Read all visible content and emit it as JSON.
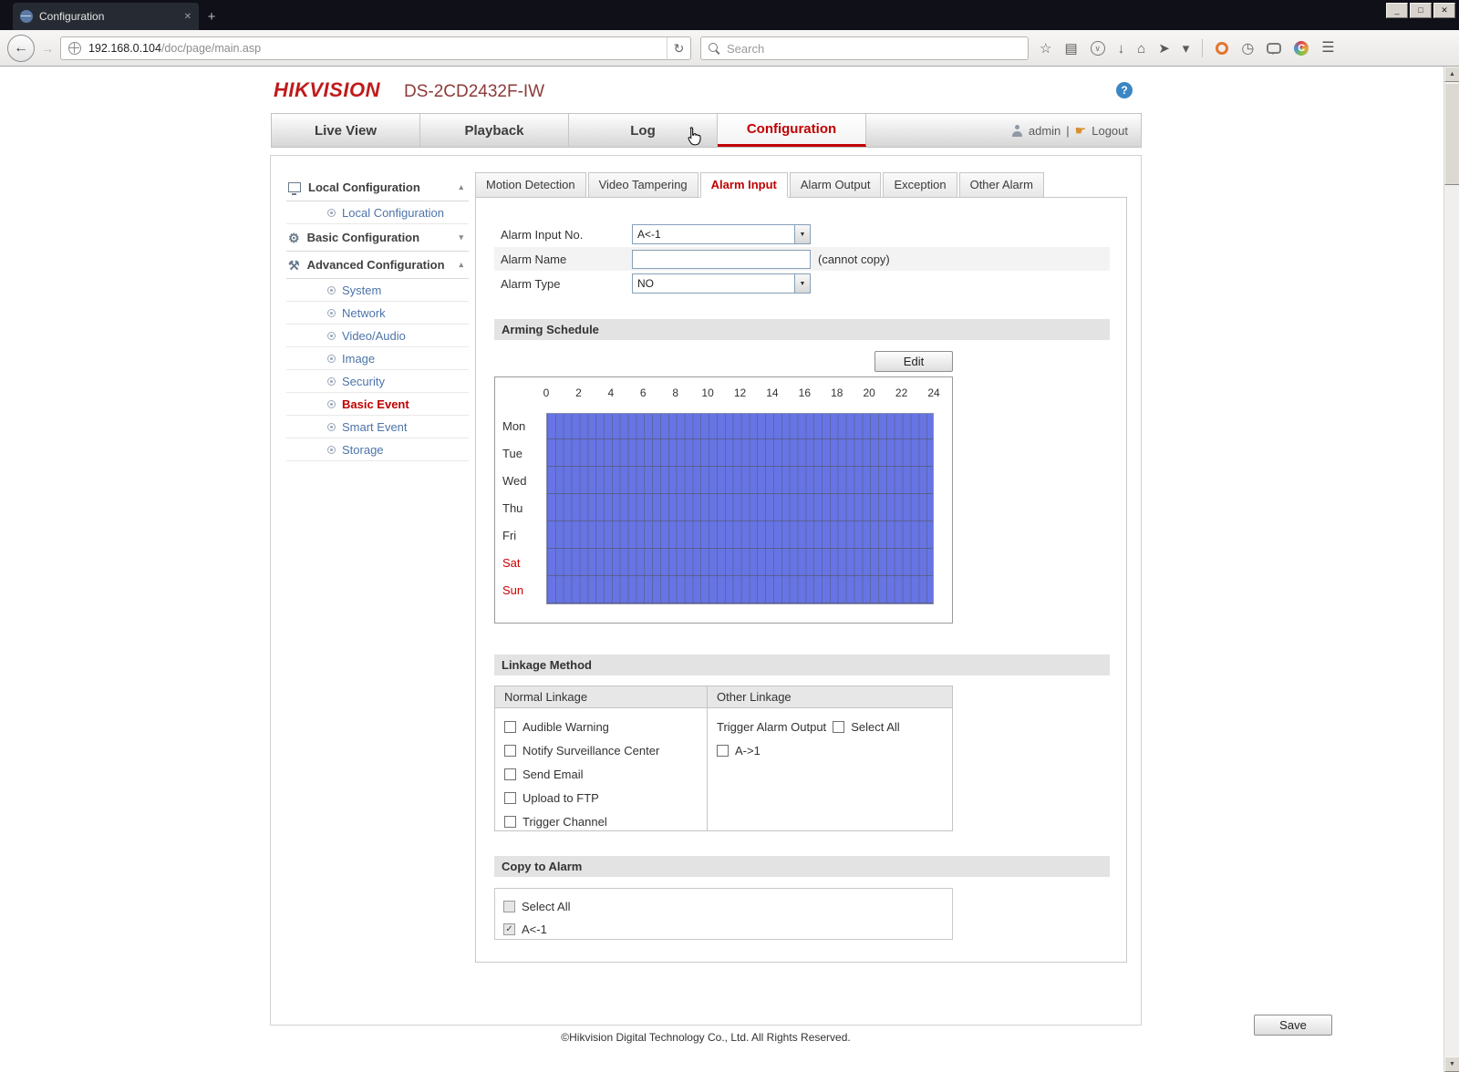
{
  "colors": {
    "accent_red": "#c00000",
    "link_blue": "#4d74a9",
    "schedule_blue": "#6674e4",
    "help_blue": "#3b86c4"
  },
  "icons": {
    "minimize": "_",
    "maximize": "□",
    "close": "✕",
    "tab_close": "✕",
    "new_tab": "+",
    "back": "←",
    "forward": "→",
    "reload": "↻",
    "star": "☆",
    "reading_list": "▤",
    "pocket": "∨",
    "download": "↓",
    "home": "⌂",
    "send": "➤",
    "caret": "▾",
    "menu": "☰",
    "clock": "◷",
    "letter_c": "C",
    "help": "?",
    "chevron_up": "▴",
    "chevron_down": "▾",
    "select_arrow": "▼",
    "check": "✓",
    "scroll_up": "▲",
    "scroll_down": "▼",
    "logout_hand": "☛"
  },
  "browser": {
    "tab_title": "Configuration",
    "url_host": "192.168.0.104",
    "url_path": "/doc/page/main.asp",
    "search_placeholder": "Search"
  },
  "page": {
    "brand": "HIKVISION",
    "model": "DS-2CD2432F-IW",
    "nav_tabs": [
      {
        "label": "Live View"
      },
      {
        "label": "Playback"
      },
      {
        "label": "Log"
      },
      {
        "label": "Configuration"
      }
    ],
    "user": "admin",
    "user_sep": "|",
    "logout_label": "Logout",
    "footer": "©Hikvision Digital Technology Co., Ltd. All Rights Reserved."
  },
  "sidebar": {
    "groups": [
      {
        "label": "Local Configuration"
      },
      {
        "label": "Basic Configuration"
      },
      {
        "label": "Advanced Configuration"
      }
    ],
    "local_items": [
      {
        "label": "Local Configuration"
      }
    ],
    "advanced_items": [
      {
        "label": "System"
      },
      {
        "label": "Network"
      },
      {
        "label": "Video/Audio"
      },
      {
        "label": "Image"
      },
      {
        "label": "Security"
      },
      {
        "label": "Basic Event"
      },
      {
        "label": "Smart Event"
      },
      {
        "label": "Storage"
      }
    ]
  },
  "content": {
    "tabs": [
      {
        "label": "Motion Detection"
      },
      {
        "label": "Video Tampering"
      },
      {
        "label": "Alarm Input"
      },
      {
        "label": "Alarm Output"
      },
      {
        "label": "Exception"
      },
      {
        "label": "Other Alarm"
      }
    ],
    "form": {
      "alarm_input_no_label": "Alarm Input No.",
      "alarm_input_no_value": "A<-1",
      "alarm_name_label": "Alarm Name",
      "alarm_name_value": "",
      "alarm_name_note": "(cannot copy)",
      "alarm_type_label": "Alarm Type",
      "alarm_type_value": "NO"
    },
    "schedule": {
      "title": "Arming Schedule",
      "edit_label": "Edit",
      "hours": [
        "0",
        "2",
        "4",
        "6",
        "8",
        "10",
        "12",
        "14",
        "16",
        "18",
        "20",
        "22",
        "24"
      ],
      "days": [
        {
          "label": "Mon"
        },
        {
          "label": "Tue"
        },
        {
          "label": "Wed"
        },
        {
          "label": "Thu"
        },
        {
          "label": "Fri"
        },
        {
          "label": "Sat"
        },
        {
          "label": "Sun"
        }
      ]
    },
    "linkage": {
      "title": "Linkage Method",
      "normal_header": "Normal Linkage",
      "other_header": "Other Linkage",
      "normal_items": [
        {
          "label": "Audible Warning"
        },
        {
          "label": "Notify Surveillance Center"
        },
        {
          "label": "Send Email"
        },
        {
          "label": "Upload to FTP"
        },
        {
          "label": "Trigger Channel"
        }
      ],
      "trigger_label": "Trigger Alarm Output",
      "select_all_label": "Select All",
      "other_items": [
        {
          "label": "A->1"
        }
      ]
    },
    "copy": {
      "title": "Copy to Alarm",
      "select_all_label": "Select All",
      "items": [
        {
          "label": "A<-1",
          "checked": true
        }
      ]
    },
    "save_label": "Save"
  }
}
